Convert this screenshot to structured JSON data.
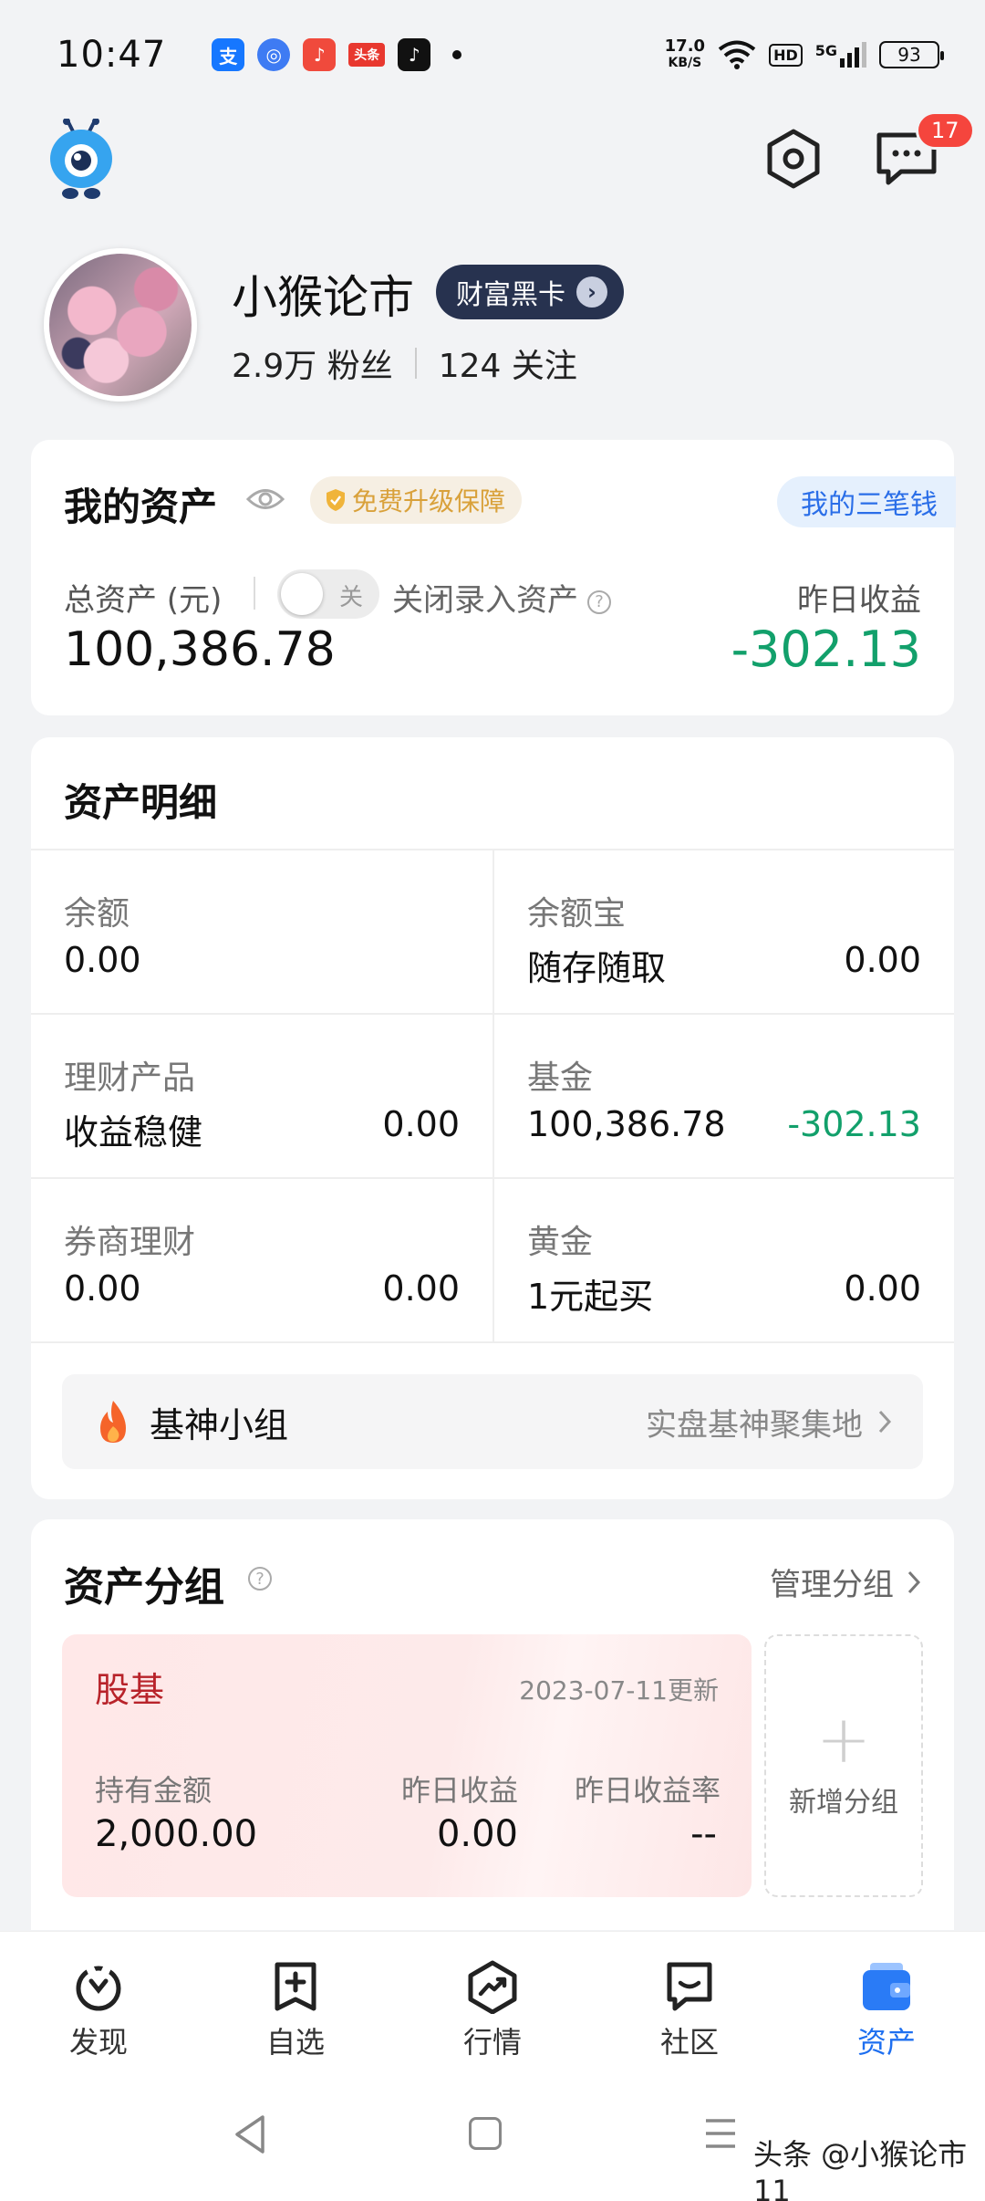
{
  "status_bar": {
    "time": "10:47",
    "notification_icons": [
      {
        "name": "alipay-icon",
        "glyph": "支",
        "color": "#1677ff"
      },
      {
        "name": "app-circle-icon",
        "glyph": "◎",
        "color": "#3e7bf3"
      },
      {
        "name": "music-app-icon",
        "glyph": "♪",
        "color": "#f04a3c"
      },
      {
        "name": "toutiao-icon",
        "glyph": "头条",
        "color": "#e8382f"
      },
      {
        "name": "tiktok-icon",
        "glyph": "♪",
        "color": "#111111"
      }
    ],
    "net_speed_value": "17.0",
    "net_speed_unit": "KB/S",
    "hd_label": "HD",
    "signal_label": "5G",
    "battery": "93"
  },
  "header": {
    "message_badge": "17"
  },
  "profile": {
    "name": "小猴论市",
    "vip_label": "财富黑卡",
    "fans_count": "2.9万",
    "fans_label": "粉丝",
    "follow_count": "124",
    "follow_label": "关注"
  },
  "assets_card": {
    "title": "我的资产",
    "upgrade_label": "免费升级保障",
    "three_money_label": "我的三笔钱",
    "total_label": "总资产 (元)",
    "toggle_text": "关",
    "close_entry_label": "关闭录入资产",
    "help_glyph": "?",
    "total_value": "100,386.78",
    "yesterday_label": "昨日收益",
    "yesterday_value": "-302.13"
  },
  "detail_card": {
    "title": "资产明细",
    "rows": [
      [
        {
          "label": "余额",
          "sub": "0.00",
          "value": ""
        },
        {
          "label": "余额宝",
          "sub": "随存随取",
          "value": "0.00"
        }
      ],
      [
        {
          "label": "理财产品",
          "sub": "收益稳健",
          "value": "0.00"
        },
        {
          "label": "基金",
          "sub": "100,386.78",
          "value": "-302.13"
        }
      ],
      [
        {
          "label": "券商理财",
          "sub": "0.00",
          "value": "0.00"
        },
        {
          "label": "黄金",
          "sub": "1元起买",
          "value": "0.00"
        }
      ]
    ],
    "group_banner": {
      "name": "基神小组",
      "desc": "实盘基神聚集地"
    }
  },
  "group_card": {
    "title": "资产分组",
    "manage_label": "管理分组",
    "group": {
      "name": "股基",
      "updated": "2023-07-11更新",
      "hold_label": "持有金额",
      "hold_value": "2,000.00",
      "yday_label": "昨日收益",
      "yday_value": "0.00",
      "rate_label": "昨日收益率",
      "rate_value": "--"
    },
    "add_label": "新增分组"
  },
  "tabbar": [
    {
      "label": "发现",
      "icon": "discover-icon",
      "active": false
    },
    {
      "label": "自选",
      "icon": "watchlist-icon",
      "active": false
    },
    {
      "label": "行情",
      "icon": "market-icon",
      "active": false
    },
    {
      "label": "社区",
      "icon": "community-icon",
      "active": false
    },
    {
      "label": "资产",
      "icon": "wallet-icon",
      "active": true
    }
  ],
  "watermark": "头条 @小猴论市11",
  "colors": {
    "accent_blue": "#1e6ff0",
    "down_green": "#12a06b",
    "group_red": "#b8232a"
  }
}
